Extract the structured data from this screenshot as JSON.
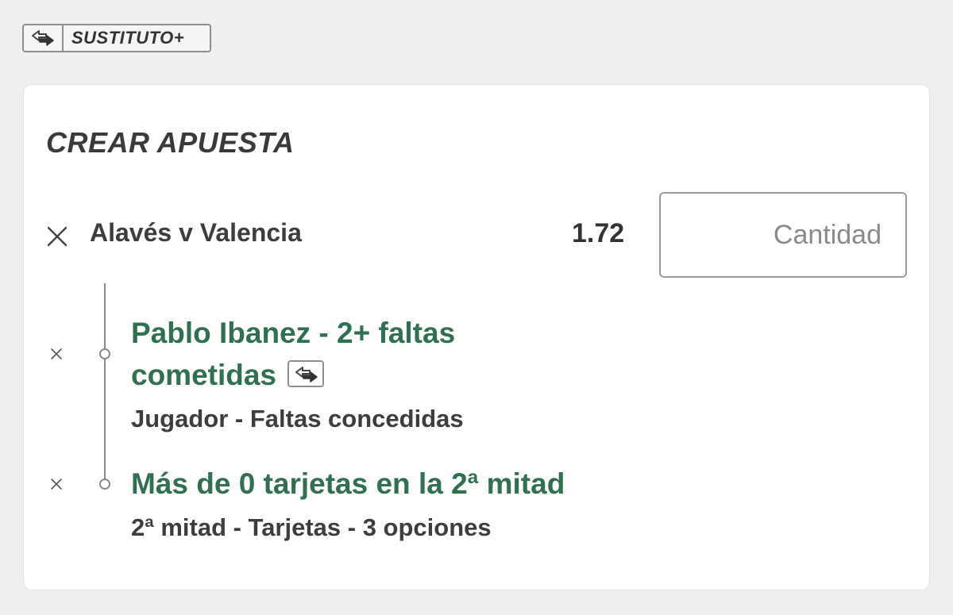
{
  "header_badge": {
    "label": "SUSTITUTO+",
    "icon": "swap-arrows-icon"
  },
  "bet_builder": {
    "title": "CREAR APUESTA",
    "match": {
      "name": "Alavés v Valencia",
      "odds": "1.72",
      "stake_placeholder": "Cantidad",
      "stake_value": ""
    },
    "selections": [
      {
        "title_line1": "Pablo Ibanez - 2+ faltas",
        "title_line2": "cometidas",
        "subtitle": "Jugador - Faltas concedidas",
        "has_sub_icon": true
      },
      {
        "title_line1": "Más de 0 tarjetas en la 2ª mitad",
        "subtitle": "2ª mitad - Tarjetas - 3 opciones",
        "has_sub_icon": false
      }
    ]
  },
  "colors": {
    "background": "#efefef",
    "card": "#ffffff",
    "selection_green": "#2f7050",
    "text_dark": "#3a3a3a",
    "border_gray": "#8e8e8e"
  }
}
